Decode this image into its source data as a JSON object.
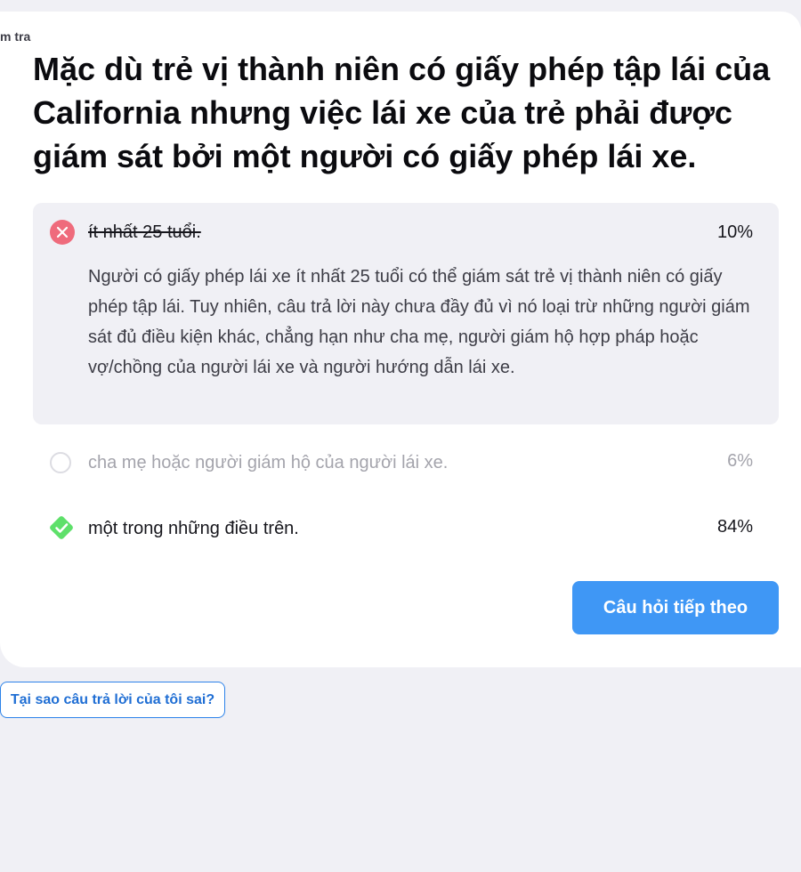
{
  "breadcrumb": "m tra",
  "question": "Mặc dù trẻ vị thành niên có giấy phép tập lái của California nhưng việc lái xe của trẻ phải được giám sát bởi một người có giấy phép lái xe.",
  "options": [
    {
      "label": "ít nhất 25 tuổi.",
      "percent": "10%",
      "status": "wrong",
      "icon": "x-circle-icon",
      "explanation": "Người có giấy phép lái xe ít nhất 25 tuổi có thể giám sát trẻ vị thành niên có giấy phép tập lái. Tuy nhiên, câu trả lời này chưa đầy đủ vì nó loại trừ những người giám sát đủ điều kiện khác, chẳng hạn như cha mẹ, người giám hộ hợp pháp hoặc vợ/chồng của người lái xe và người hướng dẫn lái xe."
    },
    {
      "label": "cha mẹ hoặc người giám hộ của người lái xe.",
      "percent": "6%",
      "status": "unselected",
      "icon": "empty-circle-icon"
    },
    {
      "label": "một trong những điều trên.",
      "percent": "84%",
      "status": "correct",
      "icon": "check-diamond-icon"
    }
  ],
  "buttons": {
    "next": "Câu hỏi tiếp theo",
    "why_wrong": "Tại sao câu trả lời của tôi sai?"
  },
  "colors": {
    "background": "#f0f0f5",
    "wrong": "#ef6b7c",
    "correct": "#5ee06a",
    "accent": "#3f97f5",
    "link": "#2c82e9"
  }
}
